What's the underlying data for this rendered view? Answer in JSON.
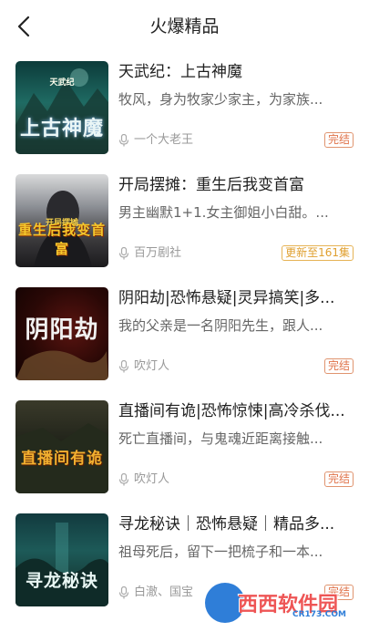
{
  "header": {
    "title": "火爆精品"
  },
  "books": [
    {
      "title": "天武纪：上古神魔",
      "desc": "牧风，身为牧家少家主，为家族...",
      "author": "一个大老王",
      "badge": "完结",
      "cover_title": "上古神魔",
      "cover_sub": "天武纪"
    },
    {
      "title": "开局摆摊：重生后我变首富",
      "desc": "男主幽默1+1.女主御姐小白甜。...",
      "author": "百万剧社",
      "badge": "更新至161集",
      "cover_title": "重生后我变首富",
      "cover_sub": "开局摆摊"
    },
    {
      "title": "阴阳劫|恐怖悬疑|灵异搞笑|多...",
      "desc": "我的父亲是一名阴阳先生，跟人...",
      "author": "吹灯人",
      "badge": "完结",
      "cover_title": "阴阳劫",
      "cover_sub": ""
    },
    {
      "title": "直播间有诡|恐怖惊悚|高冷杀伐...",
      "desc": "死亡直播间，与鬼魂近距离接触...",
      "author": "吹灯人",
      "badge": "完结",
      "cover_title": "直播间有诡",
      "cover_sub": ""
    },
    {
      "title": "寻龙秘诀｜恐怖悬疑｜精品多...",
      "desc": "祖母死后，留下一把梳子和一本...",
      "author": "白澈、国宝",
      "badge": "完结",
      "cover_title": "寻龙秘诀",
      "cover_sub": ""
    }
  ],
  "watermark": {
    "text": "西西软件园",
    "url": "CR173.COM"
  },
  "colors": {
    "badge": "#e0734a",
    "accent": "#2f7ed8"
  }
}
